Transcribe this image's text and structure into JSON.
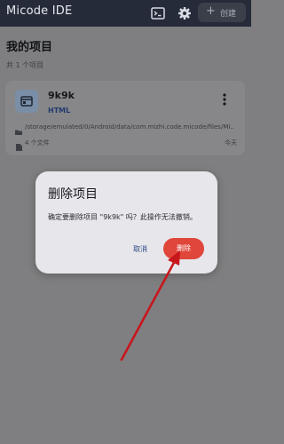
{
  "app": {
    "title": "Micode IDE",
    "create_label": "创建"
  },
  "main": {
    "title": "我的项目",
    "count": "共 1 个项目"
  },
  "project": {
    "name": "9k9k",
    "language": "HTML",
    "path": "/storage/emulated/0/Android/data/com.mizhi.code.micode/files/Mi...",
    "files": "4 个文件",
    "date": "今天"
  },
  "dialog": {
    "title": "删除项目",
    "message": "确定要删除项目 \"9k9k\" 吗？此操作无法撤销。",
    "cancel_label": "取消",
    "delete_label": "删除"
  },
  "colors": {
    "accent_delete": "#e0463a",
    "annotation_arrow": "#c8161d"
  }
}
